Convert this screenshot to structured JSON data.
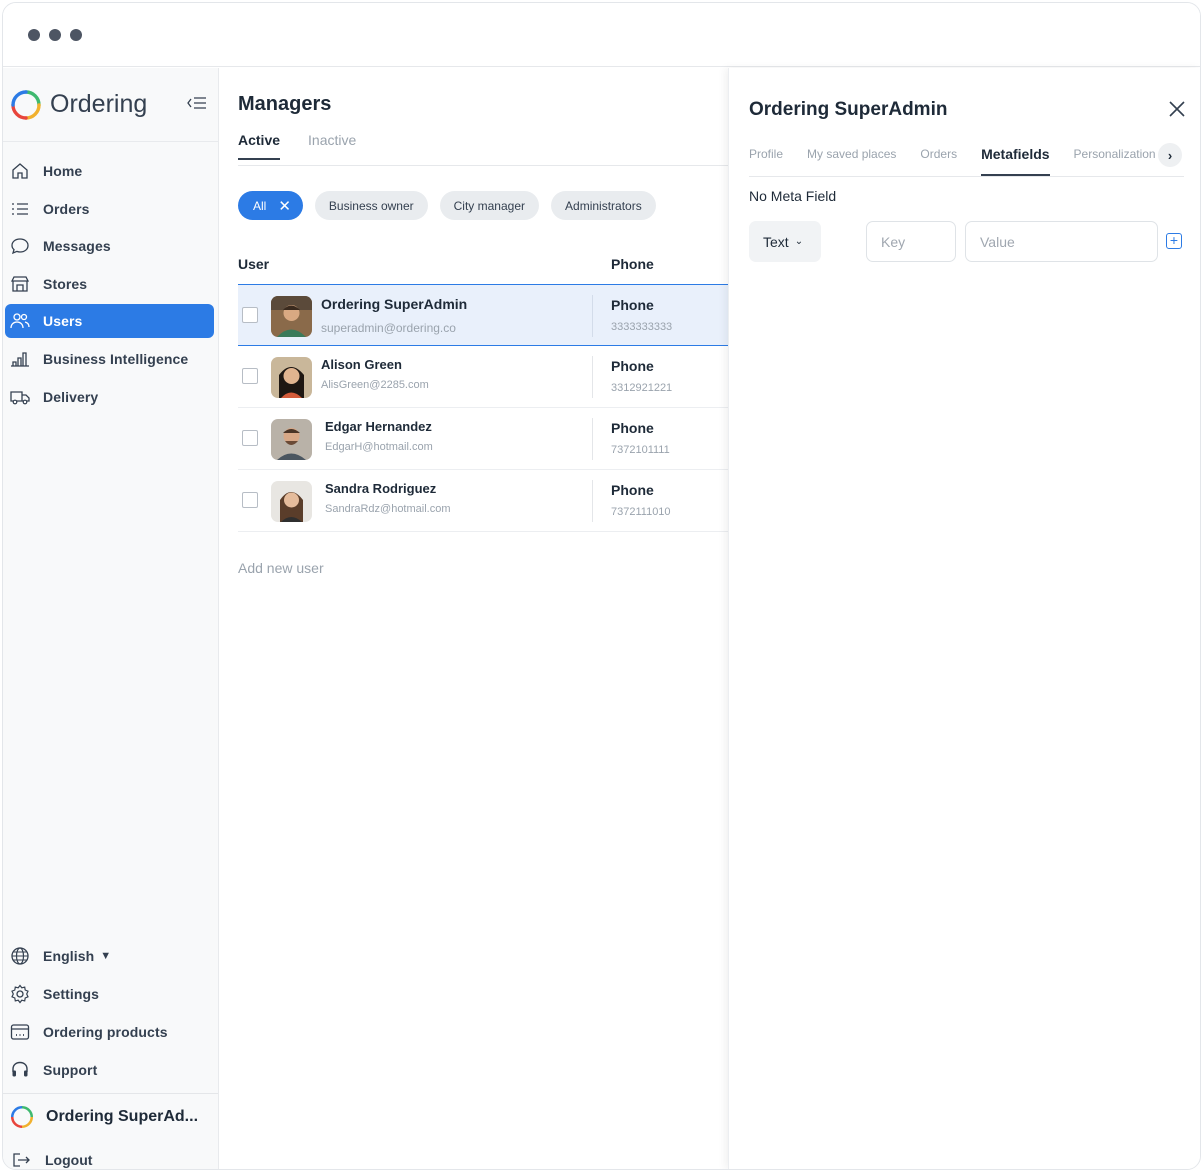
{
  "app": {
    "name": "Ordering"
  },
  "sidebar": {
    "items": [
      {
        "label": "Home",
        "icon": "home-icon"
      },
      {
        "label": "Orders",
        "icon": "list-icon"
      },
      {
        "label": "Messages",
        "icon": "chat-icon"
      },
      {
        "label": "Stores",
        "icon": "store-icon"
      },
      {
        "label": "Users",
        "icon": "users-icon",
        "active": true
      },
      {
        "label": "Business Intelligence",
        "icon": "bar-chart-icon"
      },
      {
        "label": "Delivery",
        "icon": "truck-icon"
      }
    ],
    "bottom": [
      {
        "label": "English",
        "icon": "globe-icon"
      },
      {
        "label": "Settings",
        "icon": "gear-icon"
      },
      {
        "label": "Ordering products",
        "icon": "products-icon"
      },
      {
        "label": "Support",
        "icon": "headset-icon"
      }
    ],
    "user_name": "Ordering SuperAd...",
    "logout": "Logout"
  },
  "main": {
    "title": "Managers",
    "tabs": [
      "Active",
      "Inactive"
    ],
    "filters": [
      "All",
      "Business owner",
      "City manager",
      "Administrators"
    ],
    "columns": [
      "User",
      "Phone"
    ],
    "users": [
      {
        "name": "Ordering SuperAdmin",
        "email": "superadmin@ordering.co",
        "phone_label": "Phone",
        "phone": "3333333333"
      },
      {
        "name": "Alison Green",
        "email": "AlisGreen@2285.com",
        "phone_label": "Phone",
        "phone": "3312921221"
      },
      {
        "name": "Edgar Hernandez",
        "email": "EdgarH@hotmail.com",
        "phone_label": "Phone",
        "phone": "7372101111"
      },
      {
        "name": "Sandra Rodriguez",
        "email": "SandraRdz@hotmail.com",
        "phone_label": "Phone",
        "phone": "7372111010"
      }
    ],
    "add_user": "Add new user"
  },
  "panel": {
    "title": "Ordering SuperAdmin",
    "tabs": [
      "Profile",
      "My saved places",
      "Orders",
      "Metafields",
      "Personalization"
    ],
    "active_tab": "Metafields",
    "empty_text": "No Meta Field",
    "type_value": "Text",
    "key_placeholder": "Key",
    "value_placeholder": "Value"
  },
  "colors": {
    "accent": "#2C7BE5"
  }
}
